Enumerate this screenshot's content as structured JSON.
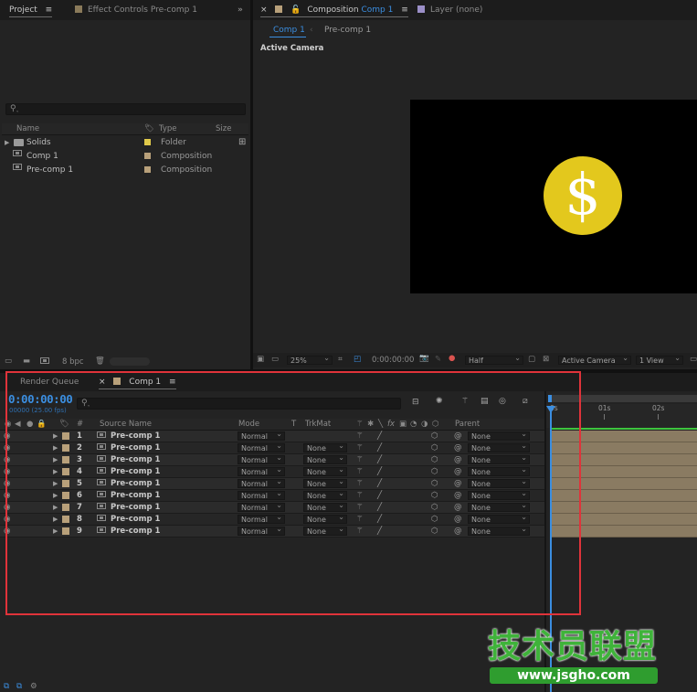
{
  "project_panel": {
    "tabs": [
      {
        "label": "Project",
        "active": true
      },
      {
        "label": "Effect Controls Pre-comp 1",
        "active": false
      }
    ],
    "search_placeholder": "",
    "columns": {
      "name": "Name",
      "type": "Type",
      "size": "Size"
    },
    "items": [
      {
        "name": "Solids",
        "type": "Folder",
        "color": "#e0c94a",
        "icon": "folder-icon"
      },
      {
        "name": "Comp 1",
        "type": "Composition",
        "color": "#b8a07a",
        "icon": "composition-icon"
      },
      {
        "name": "Pre-comp 1",
        "type": "Composition",
        "color": "#b8a07a",
        "icon": "composition-icon"
      }
    ],
    "bpc": "8 bpc"
  },
  "composition_panel": {
    "tab_label": "Composition",
    "tab_comp": "Comp 1",
    "layer_tab": "Layer (none)",
    "breadcrumbs": [
      "Comp 1",
      "Pre-comp 1"
    ],
    "view_label": "Active Camera",
    "footer": {
      "zoom": "25%",
      "timecode": "0:00:00:00",
      "resolution": "Half",
      "camera": "Active Camera",
      "views": "1 View"
    },
    "coin_symbol": "$",
    "coin_color": "#e3c81d"
  },
  "timeline_panel": {
    "tabs": [
      {
        "label": "Render Queue",
        "active": false
      },
      {
        "label": "Comp 1",
        "active": true
      }
    ],
    "timecode": "0:00:00:00",
    "fps": "00000 (25.00 fps)",
    "columns": {
      "num": "#",
      "source": "Source Name",
      "mode": "Mode",
      "t": "T",
      "trkmat": "TrkMat",
      "parent": "Parent"
    },
    "ruler": [
      "0s",
      "01s",
      "02s"
    ],
    "layers": [
      {
        "num": "1",
        "name": "Pre-comp 1",
        "mode": "Normal",
        "trkmat": "",
        "parent": "None"
      },
      {
        "num": "2",
        "name": "Pre-comp 1",
        "mode": "Normal",
        "trkmat": "None",
        "parent": "None"
      },
      {
        "num": "3",
        "name": "Pre-comp 1",
        "mode": "Normal",
        "trkmat": "None",
        "parent": "None"
      },
      {
        "num": "4",
        "name": "Pre-comp 1",
        "mode": "Normal",
        "trkmat": "None",
        "parent": "None"
      },
      {
        "num": "5",
        "name": "Pre-comp 1",
        "mode": "Normal",
        "trkmat": "None",
        "parent": "None"
      },
      {
        "num": "6",
        "name": "Pre-comp 1",
        "mode": "Normal",
        "trkmat": "None",
        "parent": "None"
      },
      {
        "num": "7",
        "name": "Pre-comp 1",
        "mode": "Normal",
        "trkmat": "None",
        "parent": "None"
      },
      {
        "num": "8",
        "name": "Pre-comp 1",
        "mode": "Normal",
        "trkmat": "None",
        "parent": "None"
      },
      {
        "num": "9",
        "name": "Pre-comp 1",
        "mode": "Normal",
        "trkmat": "None",
        "parent": "None"
      }
    ],
    "layer_color": "#b8a07a"
  },
  "watermark": {
    "text": "技术员联盟",
    "url": "www.jsgho.com"
  },
  "highlight_color": "#e0333a"
}
